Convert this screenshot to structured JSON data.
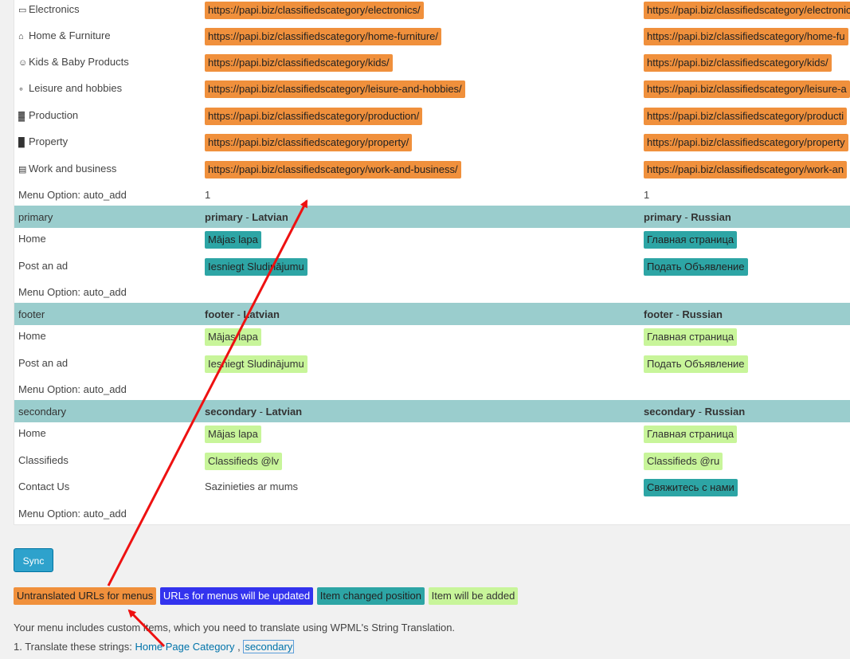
{
  "category_rows": [
    {
      "icon": "laptop-icon",
      "glyph": "💻",
      "label": "Electronics",
      "url_lv": "https://papi.biz/classifiedscategory/electronics/",
      "url_ru": "https://papi.biz/classifiedscategory/electronic"
    },
    {
      "icon": "home-icon",
      "glyph": "🏠",
      "label": "Home & Furniture",
      "url_lv": "https://papi.biz/classifiedscategory/home-furniture/",
      "url_ru": "https://papi.biz/classifiedscategory/home-fu"
    },
    {
      "icon": "smile-icon",
      "glyph": "☺",
      "label": "Kids & Baby Products",
      "url_lv": "https://papi.biz/classifiedscategory/kids/",
      "url_ru": "https://papi.biz/classifiedscategory/kids/"
    },
    {
      "icon": "bicycle-icon",
      "glyph": "🚲",
      "label": "Leisure and hobbies",
      "url_lv": "https://papi.biz/classifiedscategory/leisure-and-hobbies/",
      "url_ru": "https://papi.biz/classifiedscategory/leisure-a"
    },
    {
      "icon": "factory-icon",
      "glyph": "🏭",
      "label": "Production",
      "url_lv": "https://papi.biz/classifiedscategory/production/",
      "url_ru": "https://papi.biz/classifiedscategory/producti"
    },
    {
      "icon": "building-icon",
      "glyph": "🏢",
      "label": "Property",
      "url_lv": "https://papi.biz/classifiedscategory/property/",
      "url_ru": "https://papi.biz/classifiedscategory/property"
    },
    {
      "icon": "briefcase-icon",
      "glyph": "💼",
      "label": "Work and business",
      "url_lv": "https://papi.biz/classifiedscategory/work-and-business/",
      "url_ru": "https://papi.biz/classifiedscategory/work-an"
    }
  ],
  "category_option": {
    "label": "Menu Option: auto_add",
    "lv": "1",
    "ru": "1"
  },
  "menus": {
    "primary": {
      "name": "primary",
      "lv_name": "primary",
      "ru_name": "primary",
      "lv_lang": "Latvian",
      "ru_lang": "Russian",
      "items": [
        {
          "label": "Home",
          "lv": "Mājas lapa",
          "ru": "Главная страница"
        },
        {
          "label": "Post an ad",
          "lv": "Iesniegt Sludinājumu",
          "ru": "Подать Объявление"
        }
      ],
      "option": "Menu Option: auto_add"
    },
    "footer": {
      "name": "footer",
      "lv_name": "footer",
      "ru_name": "footer",
      "lv_lang": "Latvian",
      "ru_lang": "Russian",
      "items": [
        {
          "label": "Home",
          "lv": "Mājas lapa",
          "ru": "Главная страница"
        },
        {
          "label": "Post an ad",
          "lv": "Iesniegt Sludinājumu",
          "ru": "Подать Объявление"
        }
      ],
      "option": "Menu Option: auto_add"
    },
    "secondary": {
      "name": "secondary",
      "lv_name": "secondary",
      "ru_name": "secondary",
      "lv_lang": "Latvian",
      "ru_lang": "Russian",
      "items": [
        {
          "label": "Home",
          "lv": "Mājas lapa",
          "ru": "Главная страница"
        },
        {
          "label": "Classifieds",
          "lv": "Classifieds @lv",
          "ru": "Classifieds @ru"
        },
        {
          "label": "Contact Us",
          "lv": "Sazinieties ar mums",
          "ru": "Свяжитесь с нами"
        }
      ],
      "option": "Menu Option: auto_add"
    }
  },
  "separator": " - ",
  "sync_label": "Sync",
  "legend": {
    "untranslated": "Untranslated URLs for menus",
    "updated": "URLs for menus will be updated",
    "changed": "Item changed position",
    "added": "Item will be added"
  },
  "note": "Your menu includes custom items, which you need to translate using WPML's String Translation.",
  "strings": {
    "prefix": "1. Translate these strings: ",
    "link1": "Home Page Category",
    "comma": " , ",
    "link2": "secondary"
  },
  "colors": {
    "untranslated": "#f0903c",
    "updated": "#3333ee",
    "changed": "#2da5a5",
    "added": "#c8f59a",
    "header": "#9acdcd",
    "arrow": "#ee1111"
  }
}
